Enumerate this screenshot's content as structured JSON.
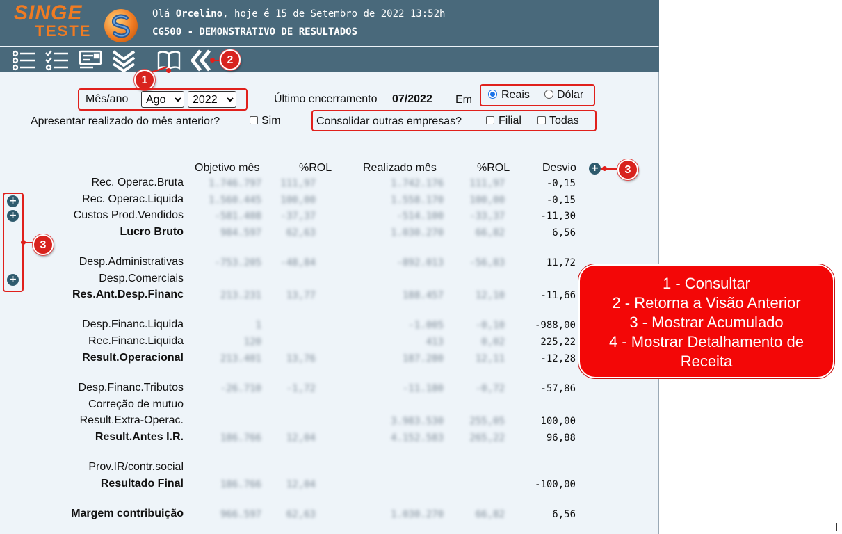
{
  "header": {
    "logo_main": "SINGE",
    "logo_sub": "TESTE",
    "greeting_prefix": "Olá ",
    "user_name": "Orcelino",
    "greeting_suffix": ", hoje é 15 de Setembro de 2022 13:52h",
    "program_title": "CG500 - DEMONSTRATIVO DE RESULTADOS"
  },
  "toolbar": {
    "icons": [
      "list-icon",
      "checklist-icon",
      "report-icon",
      "double-chevron-down-icon",
      "book-icon",
      "double-chevron-left-icon"
    ]
  },
  "filters": {
    "mes_ano_label": "Mês/ano",
    "month_value": "Ago",
    "year_value": "2022",
    "ultimo_label": "Último encerramento",
    "ultimo_value": "07/2022",
    "em_label": "Em",
    "reais_label": "Reais",
    "dolar_label": "Dólar",
    "reais_selected": true,
    "apresentar_label": "Apresentar realizado do mês anterior?",
    "sim_label": "Sim",
    "consolidar_label": "Consolidar outras empresas?",
    "filial_label": "Filial",
    "todas_label": "Todas"
  },
  "table": {
    "columns": [
      "Objetivo mês",
      "%ROL",
      "Realizado mês",
      "%ROL",
      "Desvio"
    ],
    "rows": [
      {
        "label": "Rec. Operac.Bruta",
        "bold": false,
        "obj": "1.746.797",
        "rol1": "111,97",
        "real": "1.742.176",
        "rol2": "111,97",
        "desvio": "-0,15"
      },
      {
        "label": "Rec. Operac.Liquida",
        "bold": false,
        "obj": "1.560.445",
        "rol1": "100,00",
        "real": "1.558.170",
        "rol2": "100,00",
        "desvio": "-0,15"
      },
      {
        "label": "Custos Prod.Vendidos",
        "bold": false,
        "obj": "-581.408",
        "rol1": "-37,37",
        "real": "-514.100",
        "rol2": "-33,37",
        "desvio": "-11,30"
      },
      {
        "label": "Lucro Bruto",
        "bold": true,
        "obj": "984.597",
        "rol1": "62,63",
        "real": "1.030.270",
        "rol2": "66,82",
        "desvio": "6,56"
      },
      {
        "label": "Desp.Administrativas",
        "bold": false,
        "obj": "-753.205",
        "rol1": "-48,84",
        "real": "-892.013",
        "rol2": "-56,83",
        "desvio": "11,72"
      },
      {
        "label": "Desp.Comerciais",
        "bold": false,
        "obj": "",
        "rol1": "",
        "real": "",
        "rol2": "",
        "desvio": ""
      },
      {
        "label": "Res.Ant.Desp.Financ",
        "bold": true,
        "obj": "213.231",
        "rol1": "13,77",
        "real": "188.457",
        "rol2": "12,10",
        "desvio": "-11,66"
      },
      {
        "label": "Desp.Financ.Liquida",
        "bold": false,
        "obj": "1",
        "rol1": "",
        "real": "-1.005",
        "rol2": "-0,10",
        "desvio": "-988,00"
      },
      {
        "label": "Rec.Financ.Liquida",
        "bold": false,
        "obj": "120",
        "rol1": "",
        "real": "413",
        "rol2": "0,02",
        "desvio": "225,22"
      },
      {
        "label": "Result.Operacional",
        "bold": true,
        "obj": "213.401",
        "rol1": "13,76",
        "real": "187.280",
        "rol2": "12,11",
        "desvio": "-12,28"
      },
      {
        "label": "Desp.Financ.Tributos",
        "bold": false,
        "obj": "-26.710",
        "rol1": "-1,72",
        "real": "-11.180",
        "rol2": "-0,72",
        "desvio": "-57,86"
      },
      {
        "label": "Correção de mutuo",
        "bold": false,
        "obj": "",
        "rol1": "",
        "real": "",
        "rol2": "",
        "desvio": ""
      },
      {
        "label": "Result.Extra-Operac.",
        "bold": false,
        "obj": "",
        "rol1": "",
        "real": "3.983.530",
        "rol2": "255,05",
        "desvio": "100,00"
      },
      {
        "label": "Result.Antes I.R.",
        "bold": true,
        "obj": "186.766",
        "rol1": "12,04",
        "real": "4.152.583",
        "rol2": "265,22",
        "desvio": "96,88"
      },
      {
        "label": "Prov.IR/contr.social",
        "bold": false,
        "obj": "",
        "rol1": "",
        "real": "",
        "rol2": "",
        "desvio": ""
      },
      {
        "label": "Resultado Final",
        "bold": true,
        "obj": "186.766",
        "rol1": "12,04",
        "real": "",
        "rol2": "",
        "desvio": "-100,00"
      },
      {
        "label": "Margem contribuição",
        "bold": true,
        "obj": "966.597",
        "rol1": "62,63",
        "real": "1.030.270",
        "rol2": "66,82",
        "desvio": "6,56"
      }
    ]
  },
  "badges": [
    "1",
    "2",
    "3",
    "3"
  ],
  "callout": {
    "lines": [
      "1 - Consultar",
      "2 - Retorna a Visão Anterior",
      "3 - Mostrar Acumulado",
      "4 - Mostrar Detalhamento de Receita"
    ]
  },
  "colors": {
    "header_bg": "#49697b",
    "logo_orange": "#f07b22",
    "page_bg": "#eef4f9",
    "annotation_red": "#e0201c",
    "plus_icon": "#2e5a6d"
  }
}
